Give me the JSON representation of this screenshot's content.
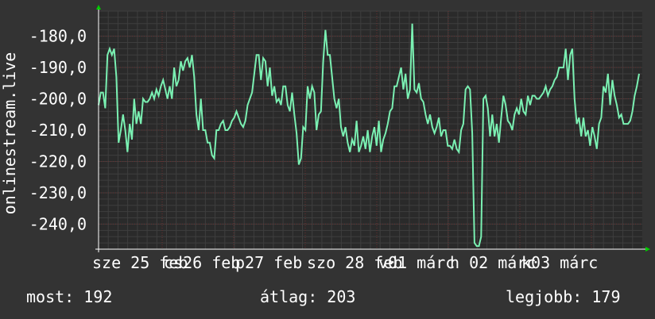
{
  "chart_data": {
    "type": "line",
    "ylabel": "onlinestream.live",
    "ylim": [
      -248,
      -172
    ],
    "y_ticks": [
      -180,
      -190,
      -200,
      -210,
      -220,
      -230,
      -240
    ],
    "y_tick_labels": [
      "-180,0",
      "-190,0",
      "-200,0",
      "-210,0",
      "-220,0",
      "-230,0",
      "-240,0"
    ],
    "x_tick_labels": [
      "sze 25 feb",
      "csüt 26 feb",
      "pén 27 feb",
      "szo 28 feb",
      "vas 01 márc",
      "hét 02 márc",
      "kedd 03 márc"
    ],
    "x_tick_label_visible": [
      "sze 25 feb",
      "cs26 feb",
      "p27 feb",
      "szo 28 feb",
      "v01 márc",
      "h 02 márc",
      "k03 márc"
    ],
    "grid": true,
    "colors": {
      "background": "#333333",
      "plot_bg": "#2a2a2a",
      "line": "#7af0b2",
      "grid": "#5a2a2a",
      "axis_arrow": "#00cc00"
    },
    "series": [
      {
        "values": [
          -202,
          -198,
          -198,
          -203,
          -186,
          -184,
          -186,
          -184,
          -193,
          -214,
          -210,
          -205,
          -210,
          -217,
          -208,
          -213,
          -200,
          -208,
          -204,
          -208,
          -200,
          -201,
          -201,
          -200,
          -198,
          -200,
          -197,
          -199,
          -196,
          -194,
          -197,
          -200,
          -196,
          -200,
          -190,
          -196,
          -194,
          -188,
          -191,
          -188,
          -187,
          -190,
          -186,
          -193,
          -205,
          -210,
          -200,
          -210,
          -210,
          -214,
          -214,
          -218,
          -219,
          -210,
          -210,
          -208,
          -207,
          -210,
          -210,
          -209,
          -207,
          -206,
          -204,
          -206,
          -208,
          -209,
          -207,
          -202,
          -200,
          -198,
          -192,
          -186,
          -186,
          -194,
          -187,
          -188,
          -196,
          -190,
          -199,
          -196,
          -201,
          -200,
          -202,
          -196,
          -196,
          -202,
          -204,
          -198,
          -205,
          -211,
          -221,
          -219,
          -209,
          -210,
          -196,
          -200,
          -196,
          -198,
          -210,
          -205,
          -204,
          -188,
          -178,
          -186,
          -186,
          -193,
          -200,
          -203,
          -200,
          -209,
          -212,
          -209,
          -214,
          -217,
          -213,
          -215,
          -207,
          -217,
          -215,
          -212,
          -216,
          -210,
          -217,
          -212,
          -209,
          -215,
          -207,
          -217,
          -213,
          -211,
          -208,
          -204,
          -203,
          -196,
          -196,
          -193,
          -190,
          -197,
          -192,
          -200,
          -197,
          -176,
          -197,
          -198,
          -195,
          -200,
          -201,
          -205,
          -208,
          -205,
          -209,
          -211,
          -209,
          -206,
          -212,
          -210,
          -210,
          -215,
          -215,
          -216,
          -213,
          -216,
          -217,
          -210,
          -208,
          -197,
          -196,
          -197,
          -211,
          -246,
          -247,
          -247,
          -244,
          -200,
          -199,
          -203,
          -212,
          -205,
          -212,
          -208,
          -214,
          -206,
          -199,
          -202,
          -207,
          -208,
          -210,
          -205,
          -203,
          -205,
          -200,
          -204,
          -205,
          -199,
          -202,
          -199,
          -199,
          -200,
          -200,
          -199,
          -198,
          -196,
          -199,
          -197,
          -196,
          -194,
          -193,
          -190,
          -190,
          -190,
          -184,
          -194,
          -186,
          -184,
          -200,
          -208,
          -206,
          -212,
          -206,
          -212,
          -210,
          -215,
          -209,
          -212,
          -216,
          -208,
          -206,
          -196,
          -198,
          -192,
          -202,
          -194,
          -199,
          -202,
          -206,
          -205,
          -208,
          -208,
          -208,
          -207,
          -204,
          -199,
          -196,
          -192
        ]
      }
    ],
    "stats": {
      "now_label": "most:",
      "now_value": "192",
      "avg_label": "átlag:",
      "avg_value": "203",
      "best_label": "legjobb:",
      "best_value": "179"
    }
  }
}
